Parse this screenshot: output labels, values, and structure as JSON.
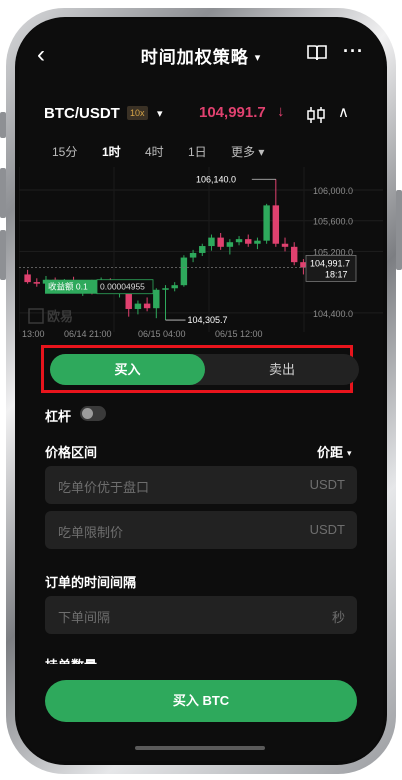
{
  "nav": {
    "back": "‹",
    "title": "时间加权策略",
    "title_caret": "▾",
    "more": "···"
  },
  "pair": {
    "symbol": "BTC/USDT",
    "leverage": "10x",
    "caret": "▾",
    "price": "104,991.7",
    "arrow": "↓",
    "collapse": "∧"
  },
  "timeframes": [
    {
      "label": "15分",
      "active": false
    },
    {
      "label": "1时",
      "active": true
    },
    {
      "label": "4时",
      "active": false
    },
    {
      "label": "1日",
      "active": false
    },
    {
      "label": "更多 ▾",
      "active": false
    }
  ],
  "chart_data": {
    "type": "candlestick",
    "y_ticks": [
      "106,000.0",
      "105,600.0",
      "105,200.0",
      "104,400.0"
    ],
    "x_ticks": [
      "13:00",
      "06/14 21:00",
      "06/15 04:00",
      "06/15 12:00"
    ],
    "high_label": "106,140.0",
    "low_label": "104,305.7",
    "last_price": "104,991.7",
    "countdown": "18:17",
    "cost_label": "收益额 0.1",
    "cost_value": "0.00004955",
    "watermark": "欧易",
    "colors": {
      "up": "#2ea95c",
      "down": "#e0416f"
    },
    "candles": [
      {
        "o": 104900,
        "h": 104960,
        "l": 104780,
        "c": 104800
      },
      {
        "o": 104800,
        "h": 104850,
        "l": 104740,
        "c": 104780
      },
      {
        "o": 104780,
        "h": 104880,
        "l": 104760,
        "c": 104830
      },
      {
        "o": 104830,
        "h": 104860,
        "l": 104700,
        "c": 104720
      },
      {
        "o": 104720,
        "h": 104840,
        "l": 104690,
        "c": 104810
      },
      {
        "o": 104810,
        "h": 104870,
        "l": 104700,
        "c": 104730
      },
      {
        "o": 104730,
        "h": 104820,
        "l": 104620,
        "c": 104790
      },
      {
        "o": 104790,
        "h": 104830,
        "l": 104640,
        "c": 104690
      },
      {
        "o": 104690,
        "h": 104860,
        "l": 104680,
        "c": 104830
      },
      {
        "o": 104830,
        "h": 104850,
        "l": 104690,
        "c": 104700
      },
      {
        "o": 104700,
        "h": 104800,
        "l": 104600,
        "c": 104760
      },
      {
        "o": 104760,
        "h": 104780,
        "l": 104350,
        "c": 104450
      },
      {
        "o": 104450,
        "h": 104560,
        "l": 104380,
        "c": 104520
      },
      {
        "o": 104520,
        "h": 104600,
        "l": 104420,
        "c": 104460
      },
      {
        "o": 104460,
        "h": 104720,
        "l": 104330,
        "c": 104700
      },
      {
        "o": 104700,
        "h": 104760,
        "l": 104306,
        "c": 104720
      },
      {
        "o": 104720,
        "h": 104800,
        "l": 104680,
        "c": 104760
      },
      {
        "o": 104760,
        "h": 105150,
        "l": 104740,
        "c": 105120
      },
      {
        "o": 105120,
        "h": 105220,
        "l": 105060,
        "c": 105180
      },
      {
        "o": 105180,
        "h": 105300,
        "l": 105140,
        "c": 105270
      },
      {
        "o": 105270,
        "h": 105420,
        "l": 105210,
        "c": 105380
      },
      {
        "o": 105380,
        "h": 105440,
        "l": 105220,
        "c": 105260
      },
      {
        "o": 105260,
        "h": 105360,
        "l": 105160,
        "c": 105320
      },
      {
        "o": 105320,
        "h": 105400,
        "l": 105280,
        "c": 105360
      },
      {
        "o": 105360,
        "h": 105420,
        "l": 105260,
        "c": 105300
      },
      {
        "o": 105300,
        "h": 105380,
        "l": 105230,
        "c": 105340
      },
      {
        "o": 105340,
        "h": 105820,
        "l": 105300,
        "c": 105800
      },
      {
        "o": 105800,
        "h": 106140,
        "l": 105260,
        "c": 105300
      },
      {
        "o": 105300,
        "h": 105380,
        "l": 105200,
        "c": 105260
      },
      {
        "o": 105260,
        "h": 105320,
        "l": 105020,
        "c": 105060
      },
      {
        "o": 105060,
        "h": 105100,
        "l": 104900,
        "c": 104990
      }
    ],
    "y_range": [
      104150,
      106300
    ]
  },
  "toggle": {
    "buy": "买入",
    "sell": "卖出"
  },
  "leverage_label": "杠杆",
  "price_range": {
    "label": "价格区间",
    "dropdown": "价距",
    "caret": "▾"
  },
  "fields": {
    "take_price": {
      "placeholder": "吃单价优于盘口",
      "unit": "USDT"
    },
    "limit_price": {
      "placeholder": "吃单限制价",
      "unit": "USDT"
    },
    "interval": {
      "placeholder": "下单间隔",
      "unit": "秒"
    }
  },
  "interval_label": "订单的时间间隔",
  "quantity_label": "挂单数量",
  "cta": "买入 BTC"
}
